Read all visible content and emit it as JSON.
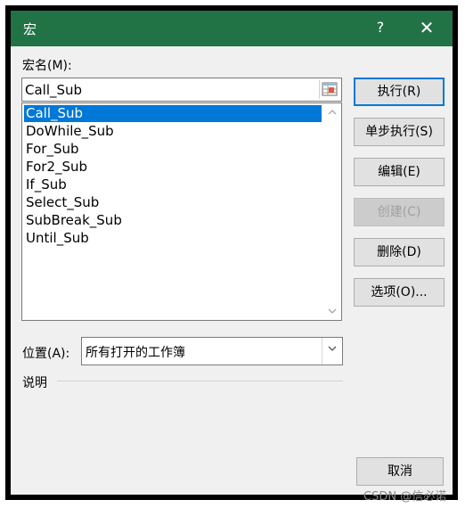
{
  "window": {
    "title": "宏",
    "help": "?",
    "close": "✕",
    "accent": "#217346"
  },
  "macro_name": {
    "label": "宏名(M):",
    "value": "Call_Sub"
  },
  "macro_list": {
    "items": [
      "Call_Sub",
      "DoWhile_Sub",
      "For_Sub",
      "For2_Sub",
      "If_Sub",
      "Select_Sub",
      "SubBreak_Sub",
      "Until_Sub"
    ],
    "selected_index": 0
  },
  "buttons": {
    "run": "执行(R)",
    "step_into": "单步执行(S)",
    "edit": "编辑(E)",
    "create": "创建(C)",
    "delete": "删除(D)",
    "options": "选项(O)...",
    "cancel": "取消"
  },
  "location": {
    "label": "位置(A):",
    "value": "所有打开的工作簿"
  },
  "description": {
    "label": "说明"
  },
  "watermark": "CSDN @信必诺"
}
